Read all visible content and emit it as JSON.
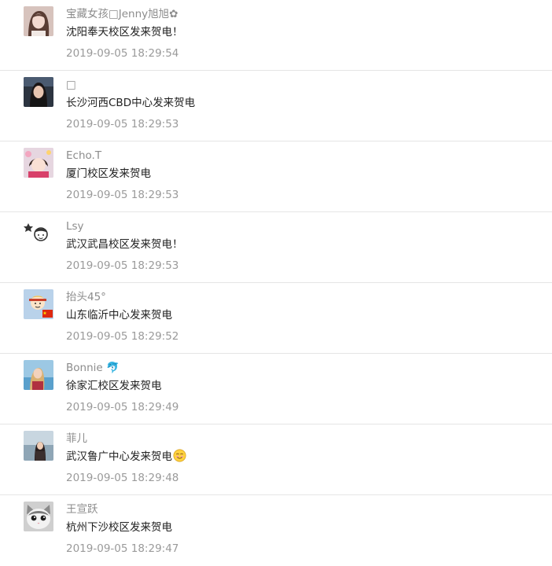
{
  "comments": [
    {
      "avatar_icon": "avatar-girl-icon",
      "name": "宝藏女孩□Jenny旭旭✿",
      "text": "沈阳奉天校区发来贺电！",
      "time": "2019-09-05 18:29:54"
    },
    {
      "avatar_icon": "avatar-woman-dark-icon",
      "name": "□",
      "text": "长沙河西CBD中心发来贺电",
      "time": "2019-09-05 18:29:53"
    },
    {
      "avatar_icon": "avatar-child-icon",
      "name": "Echo.T",
      "text": "厦门校区发来贺电",
      "time": "2019-09-05 18:29:53"
    },
    {
      "avatar_icon": "avatar-cartoon-boy-icon",
      "name": "Lsy",
      "text": "武汉武昌校区发来贺电！",
      "time": "2019-09-05 18:29:53"
    },
    {
      "avatar_icon": "avatar-cartoon-flag-icon",
      "name": "抬头45°",
      "text": "山东临沂中心发来贺电",
      "time": "2019-09-05 18:29:52"
    },
    {
      "avatar_icon": "avatar-beach-icon",
      "name": "Bonnie 🐬",
      "text": "徐家汇校区发来贺电",
      "time": "2019-09-05 18:29:49"
    },
    {
      "avatar_icon": "avatar-portrait-icon",
      "name": "菲儿",
      "text": "武汉鲁广中心发来贺电",
      "text_emoji": "smile-emoji-icon",
      "time": "2019-09-05 18:29:48"
    },
    {
      "avatar_icon": "avatar-cat-icon",
      "name": "王宣跃",
      "text": "杭州下沙校区发来贺电",
      "time": "2019-09-05 18:29:47"
    }
  ]
}
